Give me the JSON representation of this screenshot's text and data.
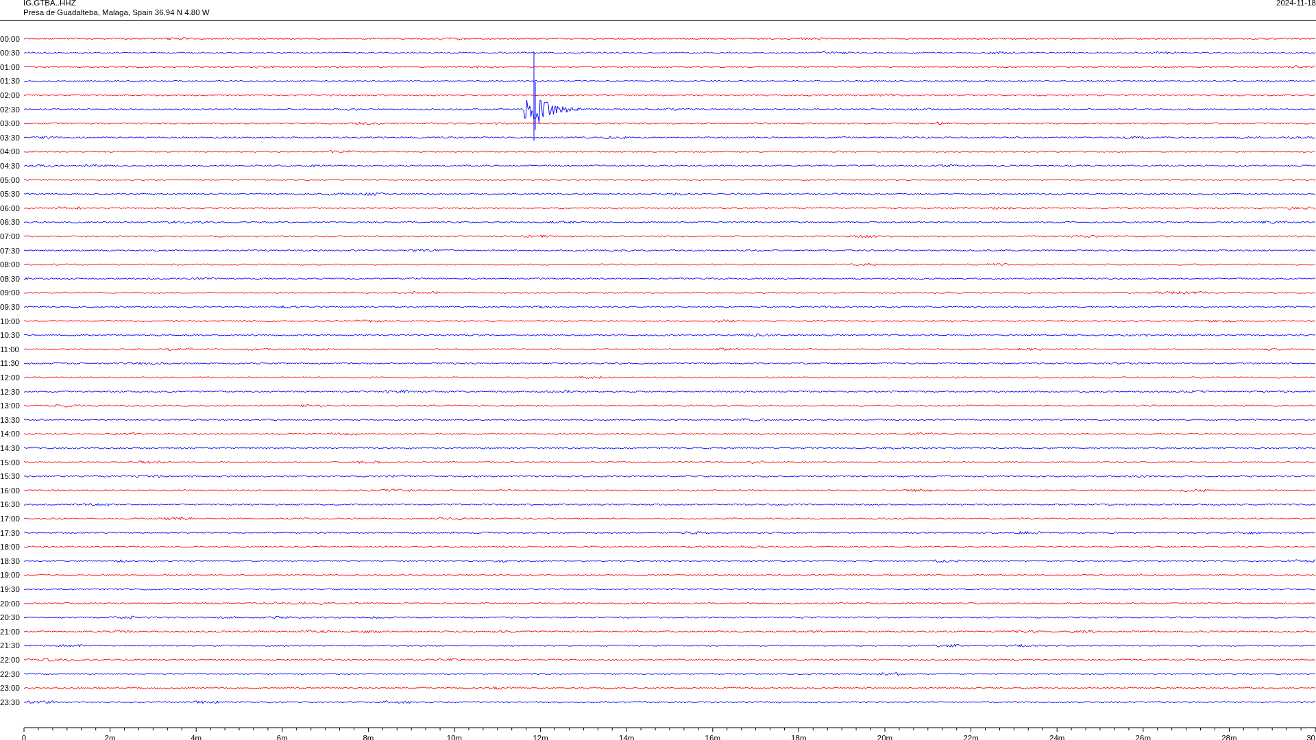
{
  "header": {
    "station": "IG.GTBA..HHZ",
    "location": "Presa de Guadalteba, Malaga, Spain  36.94 N 4.80 W",
    "date": "2024-11-18"
  },
  "rows": [
    {
      "label": "00:00",
      "color": "#ff0000",
      "kind": "trace"
    },
    {
      "label": "00:30",
      "color": "#0000ff",
      "kind": "trace"
    },
    {
      "label": "01:00",
      "color": "#ff0000",
      "kind": "trace"
    },
    {
      "label": "01:30",
      "color": "#0000ff",
      "kind": "trace"
    },
    {
      "label": "02:00",
      "color": "#ff0000",
      "kind": "trace"
    },
    {
      "label": "02:30",
      "color": "#0000ff",
      "kind": "event"
    },
    {
      "label": "03:00",
      "color": "#ff0000",
      "kind": "trace"
    },
    {
      "label": "03:30",
      "color": "#0000ff",
      "kind": "trace"
    },
    {
      "label": "04:00",
      "color": "#ff0000",
      "kind": "trace"
    },
    {
      "label": "04:30",
      "color": "#0000ff",
      "kind": "trace"
    },
    {
      "label": "05:00",
      "color": "#ff0000",
      "kind": "trace"
    },
    {
      "label": "05:30",
      "color": "#0000ff",
      "kind": "trace"
    },
    {
      "label": "06:00",
      "color": "#ff0000",
      "kind": "trace"
    },
    {
      "label": "06:30",
      "color": "#0000ff",
      "kind": "trace"
    },
    {
      "label": "07:00",
      "color": "#ff0000",
      "kind": "trace"
    },
    {
      "label": "07:30",
      "color": "#0000ff",
      "kind": "trace"
    },
    {
      "label": "08:00",
      "color": "#ff0000",
      "kind": "trace"
    },
    {
      "label": "08:30",
      "color": "#0000ff",
      "kind": "trace"
    },
    {
      "label": "09:00",
      "color": "#ff0000",
      "kind": "trace"
    },
    {
      "label": "09:30",
      "color": "#0000ff",
      "kind": "trace"
    },
    {
      "label": "10:00",
      "color": "#ff0000",
      "kind": "trace"
    },
    {
      "label": "10:30",
      "color": "#0000ff",
      "kind": "trace"
    },
    {
      "label": "11:00",
      "color": "#ff0000",
      "kind": "trace"
    },
    {
      "label": "11:30",
      "color": "#0000ff",
      "kind": "trace"
    },
    {
      "label": "12:00",
      "color": "#ff0000",
      "kind": "trace"
    },
    {
      "label": "12:30",
      "color": "#0000ff",
      "kind": "trace"
    },
    {
      "label": "13:00",
      "color": "#ff0000",
      "kind": "trace"
    },
    {
      "label": "13:30",
      "color": "#0000ff",
      "kind": "trace"
    },
    {
      "label": "14:00",
      "color": "#ff0000",
      "kind": "trace"
    },
    {
      "label": "14:30",
      "color": "#0000ff",
      "kind": "trace"
    },
    {
      "label": "15:00",
      "color": "#ff0000",
      "kind": "trace"
    },
    {
      "label": "15:30",
      "color": "#0000ff",
      "kind": "trace"
    },
    {
      "label": "16:00",
      "color": "#ff0000",
      "kind": "trace"
    },
    {
      "label": "16:30",
      "color": "#0000ff",
      "kind": "trace"
    },
    {
      "label": "17:00",
      "color": "#ff0000",
      "kind": "trace"
    },
    {
      "label": "17:30",
      "color": "#0000ff",
      "kind": "trace"
    },
    {
      "label": "18:00",
      "color": "#ff0000",
      "kind": "trace"
    },
    {
      "label": "18:30",
      "color": "#0000ff",
      "kind": "trace"
    },
    {
      "label": "19:00",
      "color": "#ff0000",
      "kind": "trace"
    },
    {
      "label": "19:30",
      "color": "#0000ff",
      "kind": "trace"
    },
    {
      "label": "20:00",
      "color": "#ff0000",
      "kind": "trace"
    },
    {
      "label": "20:30",
      "color": "#0000ff",
      "kind": "trace"
    },
    {
      "label": "21:00",
      "color": "#ff0000",
      "kind": "trace"
    },
    {
      "label": "21:30",
      "color": "#0000ff",
      "kind": "trace"
    },
    {
      "label": "22:00",
      "color": "#ff0000",
      "kind": "trace"
    },
    {
      "label": "22:30",
      "color": "#0000ff",
      "kind": "trace"
    },
    {
      "label": "23:00",
      "color": "#ff0000",
      "kind": "trace"
    },
    {
      "label": "23:30",
      "color": "#0000ff",
      "kind": "trace"
    }
  ],
  "axis": {
    "labels": [
      "0",
      "2m",
      "4m",
      "6m",
      "8m",
      "10m",
      "12m",
      "14m",
      "16m",
      "18m",
      "20m",
      "22m",
      "24m",
      "26m",
      "28m",
      "30"
    ]
  }
}
